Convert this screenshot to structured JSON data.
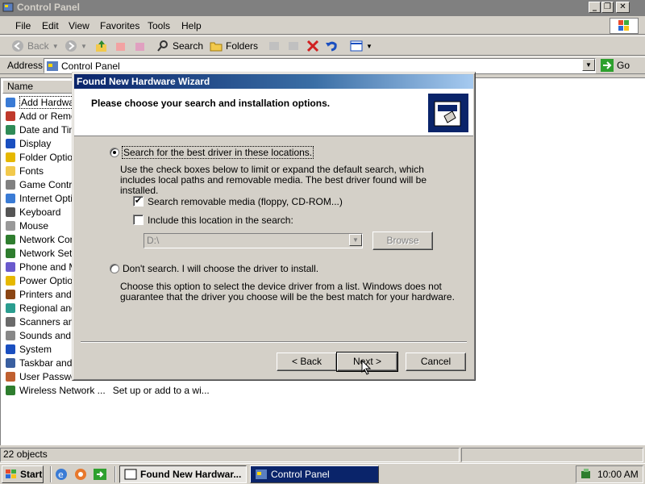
{
  "window": {
    "title": "Control Panel"
  },
  "menu": [
    "File",
    "Edit",
    "View",
    "Favorites",
    "Tools",
    "Help"
  ],
  "toolbar": {
    "back": "Back",
    "search": "Search",
    "folders": "Folders"
  },
  "address": {
    "label": "Address",
    "value": "Control Panel",
    "go": "Go"
  },
  "list": {
    "column_name": "Name",
    "items": [
      "Add Hardware",
      "Add or Remov",
      "Date and Tim",
      "Display",
      "Folder Options",
      "Fonts",
      "Game Control",
      "Internet Optio",
      "Keyboard",
      "Mouse",
      "Network Conn",
      "Network Setu",
      "Phone and M",
      "Power Option",
      "Printers and F",
      "Regional and",
      "Scanners and",
      "Sounds and A",
      "System",
      "Taskbar and",
      "User Passwor",
      "Wireless Network ..."
    ],
    "last_item_comment": "Set up or add to a wi..."
  },
  "status": {
    "count": "22 objects"
  },
  "taskbar": {
    "start": "Start",
    "tasks": [
      "Found New Hardwar...",
      "Control Panel"
    ],
    "clock": "10:00 AM"
  },
  "wizard": {
    "title": "Found New Hardware Wizard",
    "heading": "Please choose your search and installation options.",
    "option_search": "Search for the best driver in these locations.",
    "option_search_desc": "Use the check boxes below to limit or expand the default search, which includes local paths and removable media. The best driver found will be installed.",
    "check_removable": "Search removable media (floppy, CD-ROM...)",
    "check_removable_checked": true,
    "check_location": "Include this location in the search:",
    "check_location_checked": false,
    "location_value": "D:\\",
    "browse": "Browse",
    "option_dont": "Don't search. I will choose the driver to install.",
    "option_dont_desc": "Choose this option to select the device driver from a list. Windows does not guarantee that the driver you choose will be the best match for your hardware.",
    "btn_back": "< Back",
    "btn_next": "Next >",
    "btn_cancel": "Cancel"
  }
}
